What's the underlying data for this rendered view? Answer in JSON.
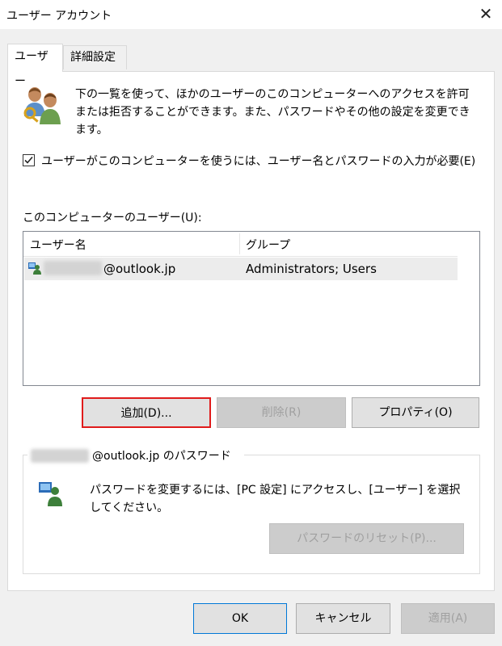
{
  "window": {
    "title": "ユーザー アカウント",
    "close_glyph": "✕"
  },
  "tabs": [
    {
      "label": "ユーザー",
      "active": true
    },
    {
      "label": "詳細設定",
      "active": false
    }
  ],
  "intro": {
    "text": "下の一覧を使って、ほかのユーザーのこのコンピューターへのアクセスを許可または拒否することができます。また、パスワードやその他の設定を変更できます。",
    "icon": "users-icon"
  },
  "require_login": {
    "label": "ユーザーがこのコンピューターを使うには、ユーザー名とパスワードの入力が必要(E)",
    "checked": true
  },
  "users_list": {
    "label": "このコンピューターのユーザー(U):",
    "columns": [
      "ユーザー名",
      "グループ"
    ],
    "rows": [
      {
        "name_suffix": "@outlook.jp",
        "group": "Administrators; Users"
      }
    ]
  },
  "buttons": {
    "add": "追加(D)...",
    "remove": "削除(R)",
    "properties": "プロパティ(O)"
  },
  "password_group": {
    "title_suffix": "@outlook.jp のパスワード",
    "text": "パスワードを変更するには、[PC 設定] にアクセスし、[ユーザー] を選択してください。",
    "reset_button": "パスワードのリセット(P)..."
  },
  "footer": {
    "ok": "OK",
    "cancel": "キャンセル",
    "apply": "適用(A)"
  },
  "colors": {
    "accent": "#0078d7",
    "highlight_border": "#e01b1b"
  }
}
